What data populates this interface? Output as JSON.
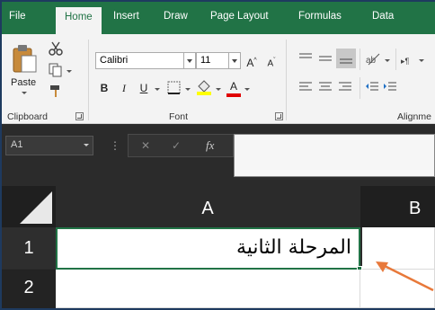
{
  "tabs": [
    "File",
    "Home",
    "Insert",
    "Draw",
    "Page Layout",
    "Formulas",
    "Data"
  ],
  "active_tab": "Home",
  "ribbon": {
    "clipboard": {
      "paste_label": "Paste",
      "group_label": "Clipboard"
    },
    "font": {
      "font_name": "Calibri",
      "font_size": "11",
      "grow_label": "A",
      "shrink_label": "A",
      "bold": "B",
      "italic": "I",
      "underline": "U",
      "font_color_label": "A",
      "group_label": "Font"
    },
    "alignment": {
      "group_label": "Alignme"
    }
  },
  "formula_bar": {
    "name_box": "A1",
    "cancel_glyph": "✕",
    "enter_glyph": "✓",
    "fx_label": "fx",
    "content": ""
  },
  "grid": {
    "columns": [
      "A",
      "B"
    ],
    "rows": [
      "1",
      "2"
    ],
    "cells": {
      "A1": "المرحلة الثانية"
    }
  },
  "colors": {
    "accent": "#217346",
    "arrow": "#e8793b"
  }
}
